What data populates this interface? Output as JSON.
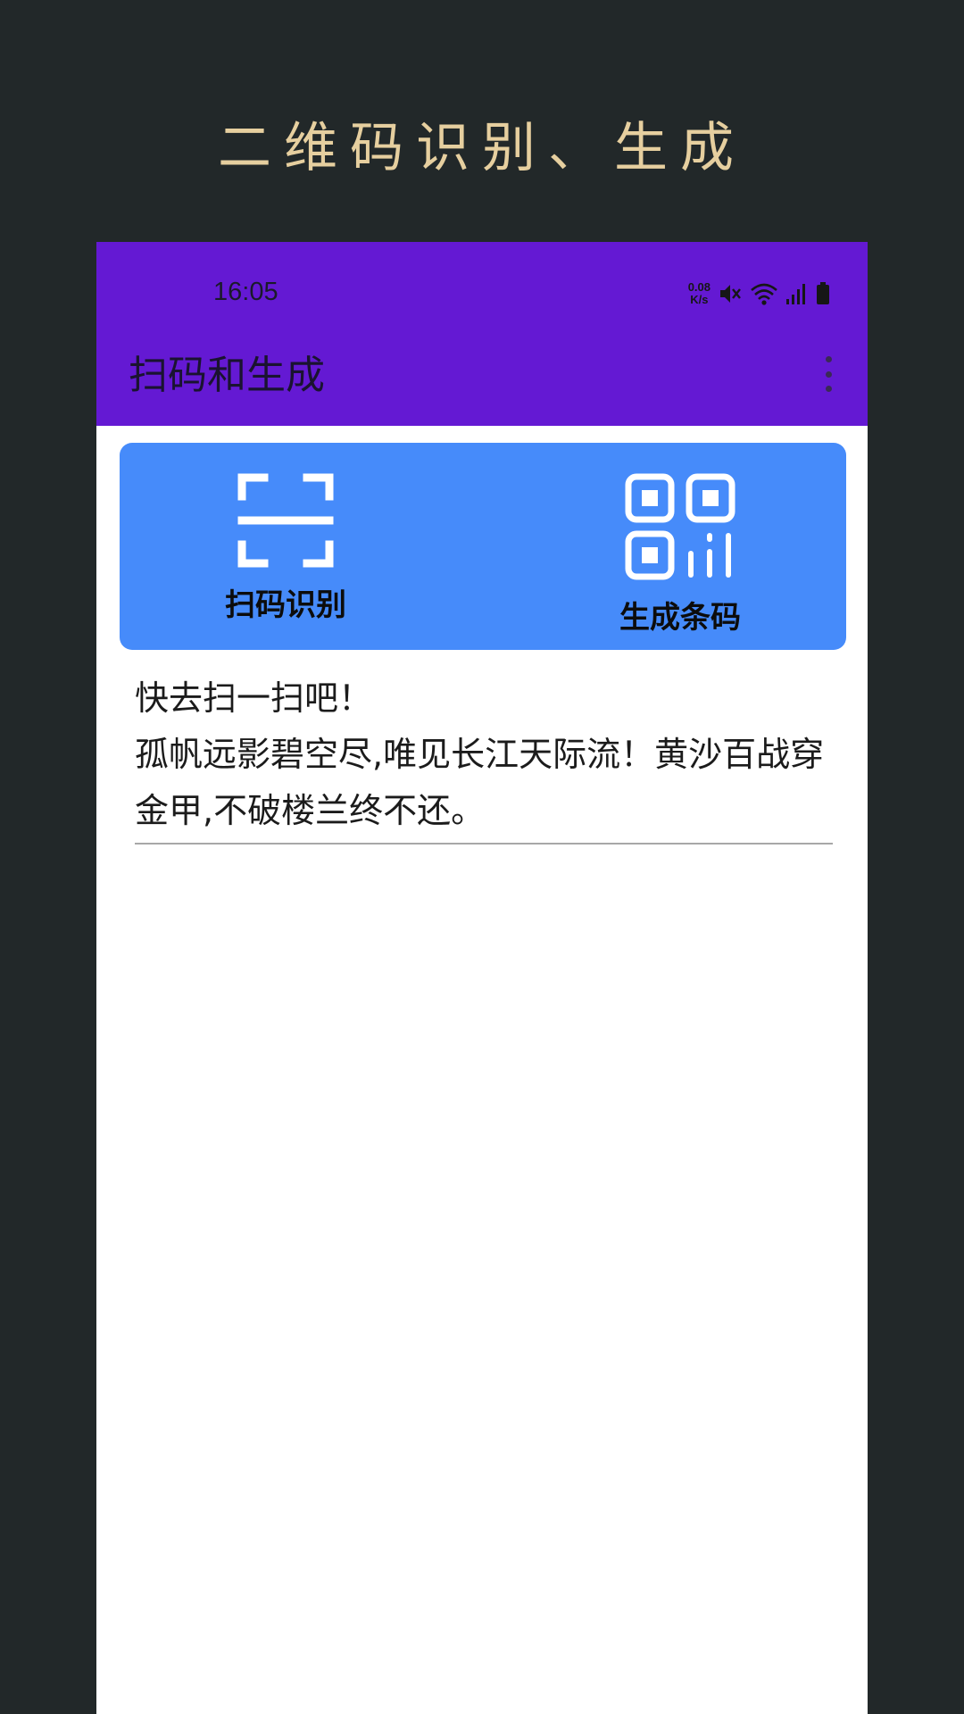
{
  "promo": {
    "title": "二维码识别、生成"
  },
  "status_bar": {
    "time": "16:05",
    "net_speed_value": "0.08",
    "net_speed_unit": "K/s",
    "icons": [
      "mute-icon",
      "wifi-icon",
      "signal-icon",
      "battery-icon"
    ]
  },
  "app_bar": {
    "title": "扫码和生成",
    "menu_icon": "more-vert-icon"
  },
  "actions": {
    "scan_label": "扫码识别",
    "scan_icon": "scan-frame-icon",
    "generate_label": "生成条码",
    "generate_icon": "qr-code-icon"
  },
  "result": {
    "line1": "快去扫一扫吧！",
    "line2": "孤帆远影碧空尽,唯见长江天际流！黄沙百战穿金甲,不破楼兰终不还。"
  },
  "colors": {
    "background": "#222829",
    "promo_text": "#e6cf9f",
    "app_bar": "#6419d3",
    "action_card": "#468bfa",
    "content_bg": "#ffffff"
  }
}
